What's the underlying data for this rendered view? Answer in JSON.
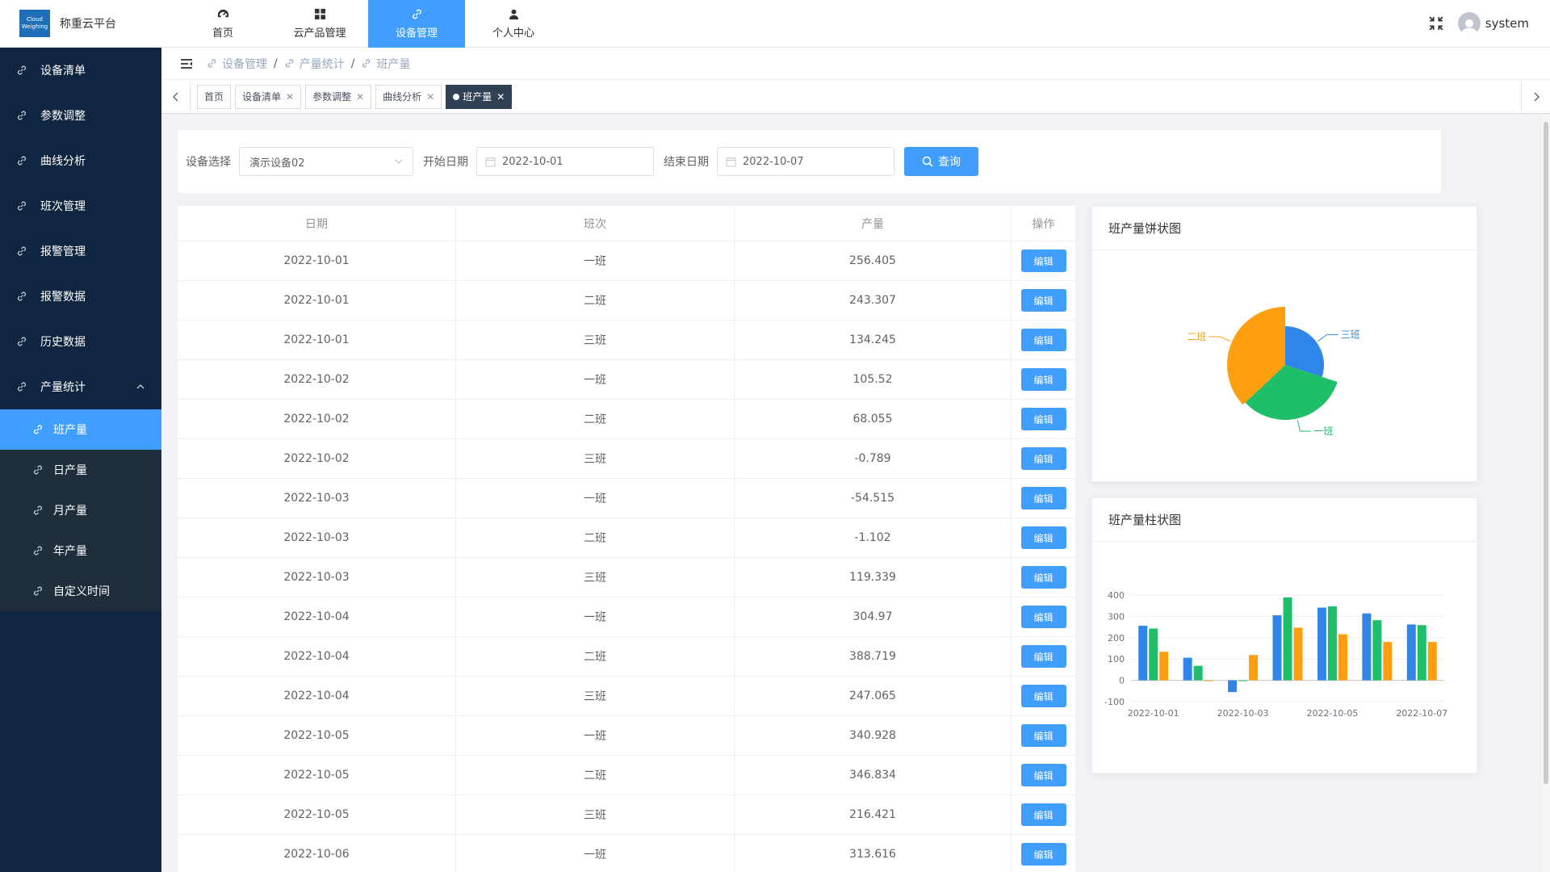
{
  "brand": {
    "logo_line1": "Cloud",
    "logo_line2": "Weighing",
    "title": "称重云平台"
  },
  "topnav": [
    {
      "label": "首页",
      "icon": "dashboard-icon",
      "active": false
    },
    {
      "label": "云产品管理",
      "icon": "grid-icon",
      "active": false
    },
    {
      "label": "设备管理",
      "icon": "link-icon",
      "active": true
    },
    {
      "label": "个人中心",
      "icon": "user-icon",
      "active": false
    }
  ],
  "user": {
    "name": "system"
  },
  "sidebar": {
    "items": [
      {
        "label": "设备清单"
      },
      {
        "label": "参数调整"
      },
      {
        "label": "曲线分析"
      },
      {
        "label": "班次管理"
      },
      {
        "label": "报警管理"
      },
      {
        "label": "报警数据"
      },
      {
        "label": "历史数据"
      },
      {
        "label": "产量统计"
      }
    ],
    "subitems": [
      {
        "label": "班产量",
        "active": true
      },
      {
        "label": "日产量"
      },
      {
        "label": "月产量"
      },
      {
        "label": "年产量"
      },
      {
        "label": "自定义时间"
      }
    ]
  },
  "breadcrumb": [
    "设备管理",
    "产量统计",
    "班产量"
  ],
  "tags": [
    {
      "label": "首页",
      "closable": false
    },
    {
      "label": "设备清单",
      "closable": true
    },
    {
      "label": "参数调整",
      "closable": true
    },
    {
      "label": "曲线分析",
      "closable": true
    },
    {
      "label": "班产量",
      "closable": true,
      "active": true
    }
  ],
  "filter": {
    "device_label": "设备选择",
    "device_value": "演示设备02",
    "start_label": "开始日期",
    "start_value": "2022-10-01",
    "end_label": "结束日期",
    "end_value": "2022-10-07",
    "search_label": "查询"
  },
  "table": {
    "headers": [
      "日期",
      "班次",
      "产量",
      "操作"
    ],
    "edit_label": "编辑",
    "rows": [
      [
        "2022-10-01",
        "一班",
        "256.405"
      ],
      [
        "2022-10-01",
        "二班",
        "243.307"
      ],
      [
        "2022-10-01",
        "三班",
        "134.245"
      ],
      [
        "2022-10-02",
        "一班",
        "105.52"
      ],
      [
        "2022-10-02",
        "二班",
        "68.055"
      ],
      [
        "2022-10-02",
        "三班",
        "-0.789"
      ],
      [
        "2022-10-03",
        "一班",
        "-54.515"
      ],
      [
        "2022-10-03",
        "二班",
        "-1.102"
      ],
      [
        "2022-10-03",
        "三班",
        "119.339"
      ],
      [
        "2022-10-04",
        "一班",
        "304.97"
      ],
      [
        "2022-10-04",
        "二班",
        "388.719"
      ],
      [
        "2022-10-04",
        "三班",
        "247.065"
      ],
      [
        "2022-10-05",
        "一班",
        "340.928"
      ],
      [
        "2022-10-05",
        "二班",
        "346.834"
      ],
      [
        "2022-10-05",
        "三班",
        "216.421"
      ],
      [
        "2022-10-06",
        "一班",
        "313.616"
      ]
    ]
  },
  "pie_card": {
    "title": "班产量饼状图"
  },
  "bar_card": {
    "title": "班产量柱状图"
  },
  "colors": {
    "accent": "#409eff",
    "shift1": "#1fbf6a",
    "shift2": "#ff9f0f",
    "shift3": "#2f86e8",
    "sidebar": "#0f2540"
  },
  "chart_data": [
    {
      "type": "pie",
      "title": "班产量饼状图",
      "labels": [
        "三班",
        "一班",
        "二班"
      ],
      "values": [
        30,
        33,
        37
      ],
      "colors": [
        "#2f86e8",
        "#1fbf6a",
        "#ff9f0f"
      ]
    },
    {
      "type": "bar",
      "title": "班产量柱状图",
      "categories": [
        "2022-10-01",
        "2022-10-02",
        "2022-10-03",
        "2022-10-04",
        "2022-10-05",
        "2022-10-06",
        "2022-10-07"
      ],
      "xticks": [
        "2022-10-01",
        "2022-10-03",
        "2022-10-05",
        "2022-10-07"
      ],
      "series": [
        {
          "values": [
            256,
            106,
            -55,
            305,
            341,
            314,
            262
          ],
          "color": "#2f86e8"
        },
        {
          "values": [
            243,
            68,
            -1,
            389,
            347,
            282,
            259
          ],
          "color": "#1fbf6a"
        },
        {
          "values": [
            134,
            -1,
            119,
            247,
            216,
            180,
            180
          ],
          "color": "#ff9f0f"
        }
      ],
      "ylim": [
        -100,
        400
      ],
      "yticks": [
        -100,
        0,
        100,
        200,
        300,
        400
      ]
    }
  ]
}
